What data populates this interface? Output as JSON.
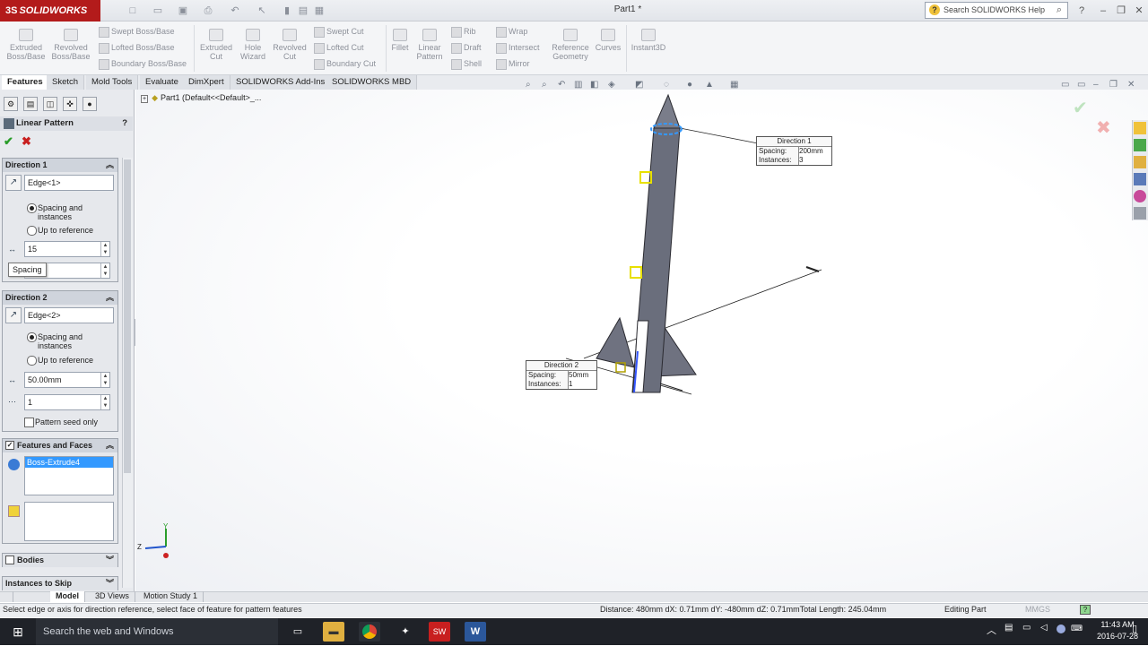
{
  "app": {
    "logo": "SOLIDWORKS",
    "doc_title": "Part1 *",
    "search_placeholder": "Search SOLIDWORKS Help",
    "help": "?",
    "minimize": "–",
    "restore": "❐",
    "close": "✕"
  },
  "ribbon": {
    "extruded_boss": "Extruded Boss/Base",
    "revolved_boss": "Revolved Boss/Base",
    "swept_boss": "Swept Boss/Base",
    "lofted_boss": "Lofted Boss/Base",
    "boundary_boss": "Boundary Boss/Base",
    "extruded_cut": "Extruded Cut",
    "hole_wizard": "Hole Wizard",
    "revolved_cut": "Revolved Cut",
    "swept_cut": "Swept Cut",
    "lofted_cut": "Lofted Cut",
    "boundary_cut": "Boundary Cut",
    "fillet": "Fillet",
    "linear_pattern": "Linear Pattern",
    "rib": "Rib",
    "draft": "Draft",
    "shell": "Shell",
    "wrap": "Wrap",
    "intersect": "Intersect",
    "mirror": "Mirror",
    "reference_geometry": "Reference Geometry",
    "curves": "Curves",
    "instant3d": "Instant3D"
  },
  "tabs": [
    "Features",
    "Sketch",
    "Mold Tools",
    "Evaluate",
    "DimXpert",
    "SOLIDWORKS Add-Ins",
    "SOLIDWORKS MBD"
  ],
  "panel": {
    "title": "Linear Pattern",
    "help": "?",
    "ok": "✔",
    "cancel": "✖",
    "dir1": {
      "title": "Direction 1",
      "edge": "Edge<1>",
      "spacing_instances": "Spacing and instances",
      "up_to_reference": "Up to reference",
      "spacing_value": "15",
      "tooltip": "Spacing"
    },
    "dir2": {
      "title": "Direction 2",
      "edge": "Edge<2>",
      "spacing_instances": "Spacing and instances",
      "up_to_reference": "Up to reference",
      "spacing_value": "50.00mm",
      "instances_value": "1",
      "seed_only": "Pattern seed only"
    },
    "features_faces": {
      "title": "Features and Faces",
      "item": "Boss-Extrude4"
    },
    "bodies": "Bodies",
    "instances_skip": "Instances to Skip"
  },
  "tree": {
    "part_label": "Part1  (Default<<Default>_..."
  },
  "callout1": {
    "title": "Direction 1",
    "spacing_label": "Spacing:",
    "spacing_value": "200mm",
    "instances_label": "Instances:",
    "instances_value": "3"
  },
  "callout2": {
    "title": "Direction 2",
    "spacing_label": "Spacing:",
    "spacing_value": "50mm",
    "instances_label": "Instances:",
    "instances_value": "1"
  },
  "axes": {
    "y": "Y",
    "z": "Z"
  },
  "bottom_tabs": [
    "Model",
    "3D Views",
    "Motion Study 1"
  ],
  "status": {
    "hint": "Select edge or axis for direction reference, select face of feature for pattern features",
    "measure": "Distance: 480mm   dX: 0.71mm   dY: -480mm   dZ: 0.71mmTotal Length: 245.04mm",
    "mode": "Editing Part",
    "units": "MMGS"
  },
  "taskbar": {
    "search": "Search the web and Windows",
    "time": "11:43 AM",
    "date": "2016-07-28"
  },
  "colors": {
    "brand": "#b31b1b",
    "model": "#6a6e7c",
    "selection": "#3399ff"
  }
}
